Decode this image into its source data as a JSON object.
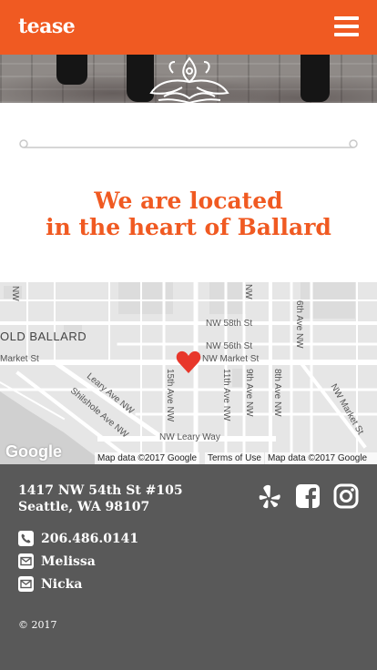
{
  "header": {
    "logo": "tease",
    "menu_icon": "hamburger-menu-icon",
    "brand_color": "#f05a22"
  },
  "heading": {
    "line1": "We are located",
    "line2": "in the heart of Ballard"
  },
  "map": {
    "labels": {
      "old_ballard": "OLD BALLARD",
      "market_st_left": "Market St",
      "nw_58th": "NW 58th St",
      "nw_56th": "NW 56th St",
      "nw_market_st": "NW Market St",
      "leary_ave": "Leary Ave NW",
      "shilshole": "Shilshole Ave NW",
      "ave_15th": "15th Ave NW",
      "ave_11th": "11th Ave NW",
      "ave_9th": "9th Ave NW",
      "ave_8th": "8th Ave NW",
      "ave_6th": "6th Ave NW",
      "nw_market_st_diag": "NW Market St",
      "nw_leary_way": "NW Leary Way",
      "nw_top_left": "NW",
      "nw_top_mid": "NW"
    },
    "google_logo": "Google",
    "attribution_1": "Map data ©2017 Google",
    "terms": "Terms of Use",
    "attribution_2": "Map data ©2017 Google",
    "marker_icon": "heart-marker-icon",
    "marker_color": "#e8372b"
  },
  "footer": {
    "address_line1": "1417 NW 54th St #105",
    "address_line2": "Seattle, WA 98107",
    "phone": "206.486.0141",
    "email1": "Melissa",
    "email2": "Nicka",
    "copyright": "© 2017",
    "social_icons": [
      "yelp-icon",
      "facebook-icon",
      "instagram-icon"
    ],
    "background": "#595959"
  }
}
